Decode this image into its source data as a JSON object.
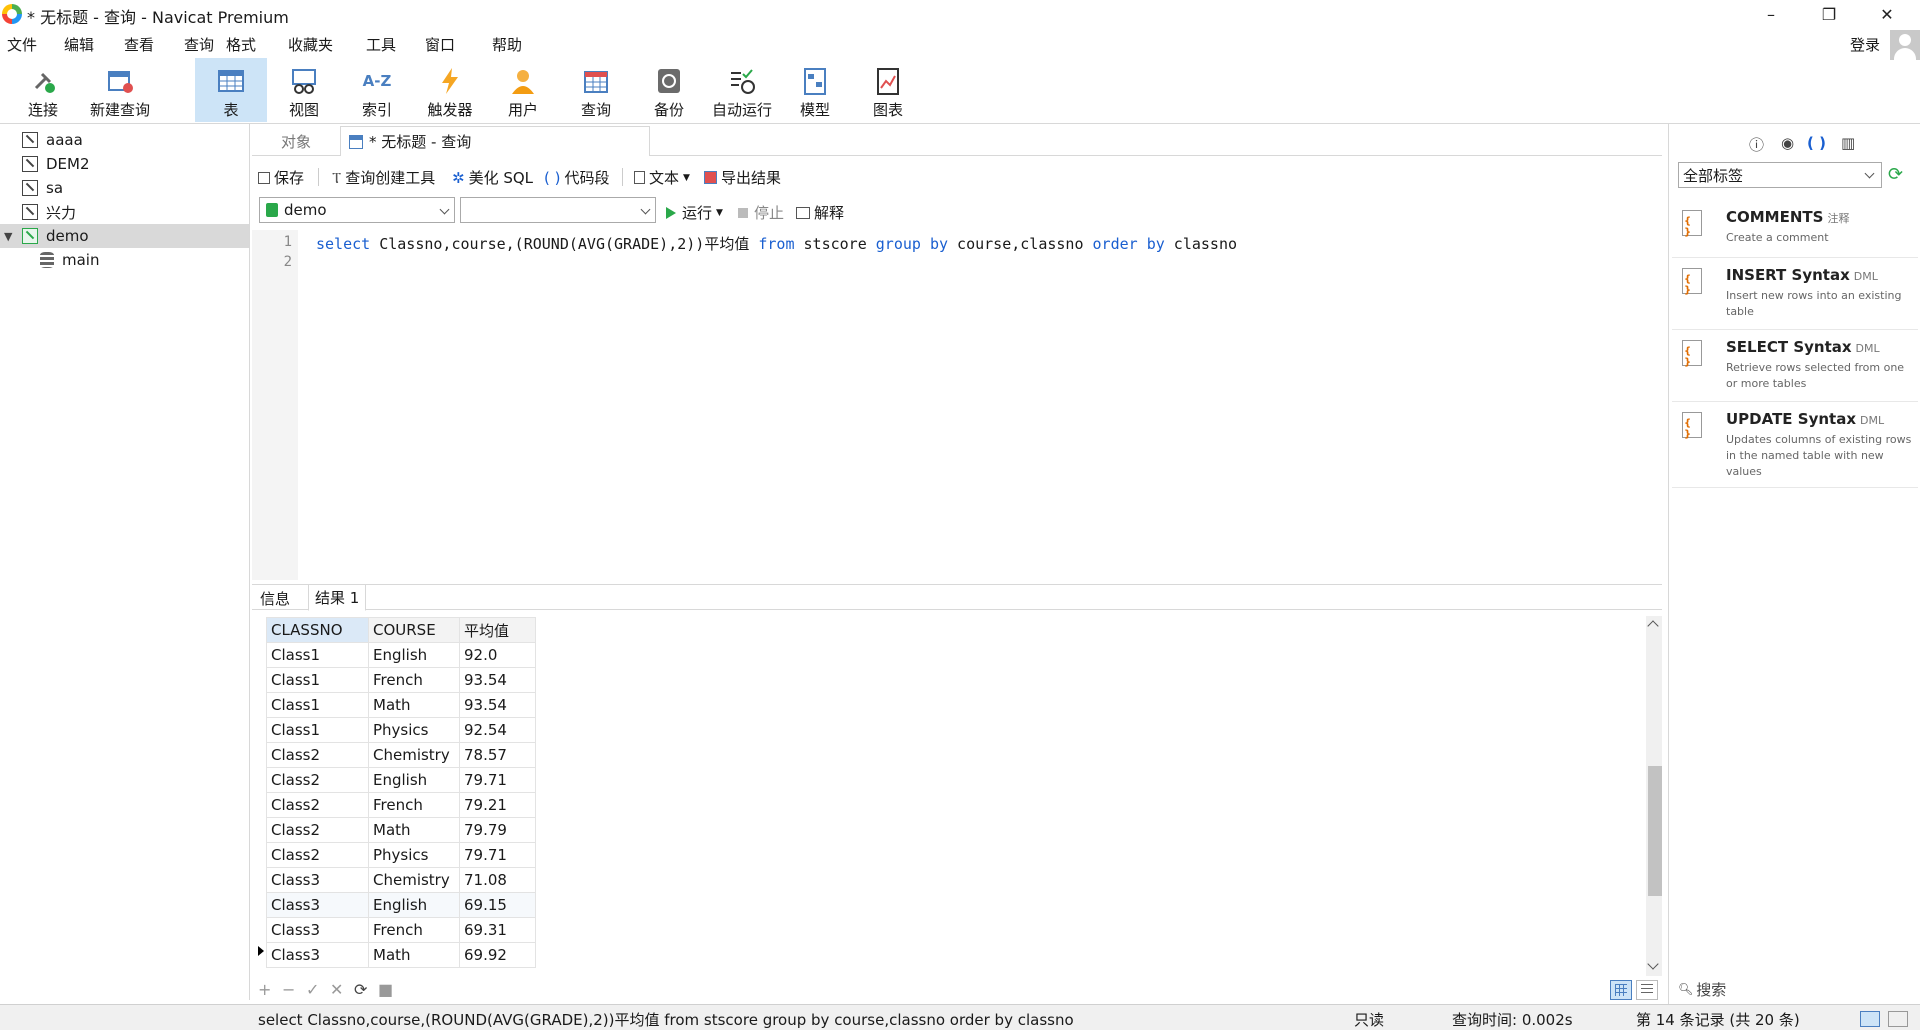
{
  "window": {
    "title": "* 无标题 - 查询 - Navicat Premium",
    "minimize": "–",
    "maximize": "❐",
    "close": "✕"
  },
  "menu": [
    "文件",
    "编辑",
    "查看",
    "查询",
    "格式",
    "收藏夹",
    "工具",
    "窗口",
    "帮助"
  ],
  "account": {
    "login": "登录"
  },
  "toolbar": [
    {
      "label": "连接",
      "icon": "plug-icon"
    },
    {
      "label": "新建查询",
      "icon": "new-query-icon"
    },
    {
      "label": "表",
      "icon": "table-icon",
      "active": true
    },
    {
      "label": "视图",
      "icon": "view-icon"
    },
    {
      "label": "索引",
      "icon": "index-icon",
      "glyph": "A-Z"
    },
    {
      "label": "触发器",
      "icon": "trigger-icon"
    },
    {
      "label": "用户",
      "icon": "user-icon"
    },
    {
      "label": "查询",
      "icon": "query-icon"
    },
    {
      "label": "备份",
      "icon": "backup-icon"
    },
    {
      "label": "自动运行",
      "icon": "automation-icon"
    },
    {
      "label": "模型",
      "icon": "model-icon"
    },
    {
      "label": "图表",
      "icon": "chart-icon"
    }
  ],
  "tree": [
    {
      "label": "aaaa",
      "type": "connection"
    },
    {
      "label": "DEM2",
      "type": "connection"
    },
    {
      "label": "sa",
      "type": "connection"
    },
    {
      "label": "兴力",
      "type": "connection"
    },
    {
      "label": "demo",
      "type": "connection-open",
      "expanded": true,
      "selected": true
    },
    {
      "label": "main",
      "type": "database"
    }
  ],
  "tabs": {
    "objects": "对象",
    "query": "* 无标题 - 查询"
  },
  "query_toolbar": {
    "save": "保存",
    "builder": "查询创建工具",
    "beautify": "美化 SQL",
    "snippet": "代码段",
    "text": "文本",
    "export": "导出结果",
    "run": "运行",
    "stop": "停止",
    "explain": "解释"
  },
  "selectors": {
    "connection": "demo",
    "database": ""
  },
  "editor": {
    "line_numbers": [
      "1",
      "2"
    ],
    "sql": "select Classno,course,(ROUND(AVG(GRADE),2))平均值 from stscore group by course,classno order by classno"
  },
  "result_tabs": {
    "info": "信息",
    "result1": "结果 1"
  },
  "results": {
    "columns": [
      "CLASSNO",
      "COURSE",
      "平均值"
    ],
    "rows": [
      [
        "Class1",
        "English",
        "92.0"
      ],
      [
        "Class1",
        "French",
        "93.54"
      ],
      [
        "Class1",
        "Math",
        "93.54"
      ],
      [
        "Class1",
        "Physics",
        "92.54"
      ],
      [
        "Class2",
        "Chemistry",
        "78.57"
      ],
      [
        "Class2",
        "English",
        "79.71"
      ],
      [
        "Class2",
        "French",
        "79.21"
      ],
      [
        "Class2",
        "Math",
        "79.79"
      ],
      [
        "Class2",
        "Physics",
        "79.71"
      ],
      [
        "Class3",
        "Chemistry",
        "71.08"
      ],
      [
        "Class3",
        "English",
        "69.15"
      ],
      [
        "Class3",
        "French",
        "69.31"
      ],
      [
        "Class3",
        "Math",
        "69.92"
      ]
    ]
  },
  "grid_footer": {
    "add": "+",
    "remove": "−",
    "apply": "✓",
    "discard": "✕",
    "refresh": "⟳",
    "stop": "■"
  },
  "right_panel": {
    "tag_filter": "全部标签",
    "snippets": [
      {
        "title": "COMMENTS",
        "tag": "注释",
        "desc": "Create a comment"
      },
      {
        "title": "INSERT Syntax",
        "tag": "DML",
        "desc": "Insert new rows into an existing table"
      },
      {
        "title": "SELECT Syntax",
        "tag": "DML",
        "desc": "Retrieve rows selected from one or more tables"
      },
      {
        "title": "UPDATE Syntax",
        "tag": "DML",
        "desc": "Updates columns of existing rows in the named table with new values"
      }
    ],
    "search_placeholder": "搜索"
  },
  "status": {
    "sql": "select Classno,course,(ROUND(AVG(GRADE),2))平均值 from stscore group by course,classno order by classno",
    "readonly": "只读",
    "query_time": "查询时间: 0.002s",
    "records": "第 14 条记录 (共 20 条)"
  },
  "colors": {
    "accent": "#1a5fd0",
    "selection": "#cde4f7",
    "run_green": "#2aa84a"
  }
}
